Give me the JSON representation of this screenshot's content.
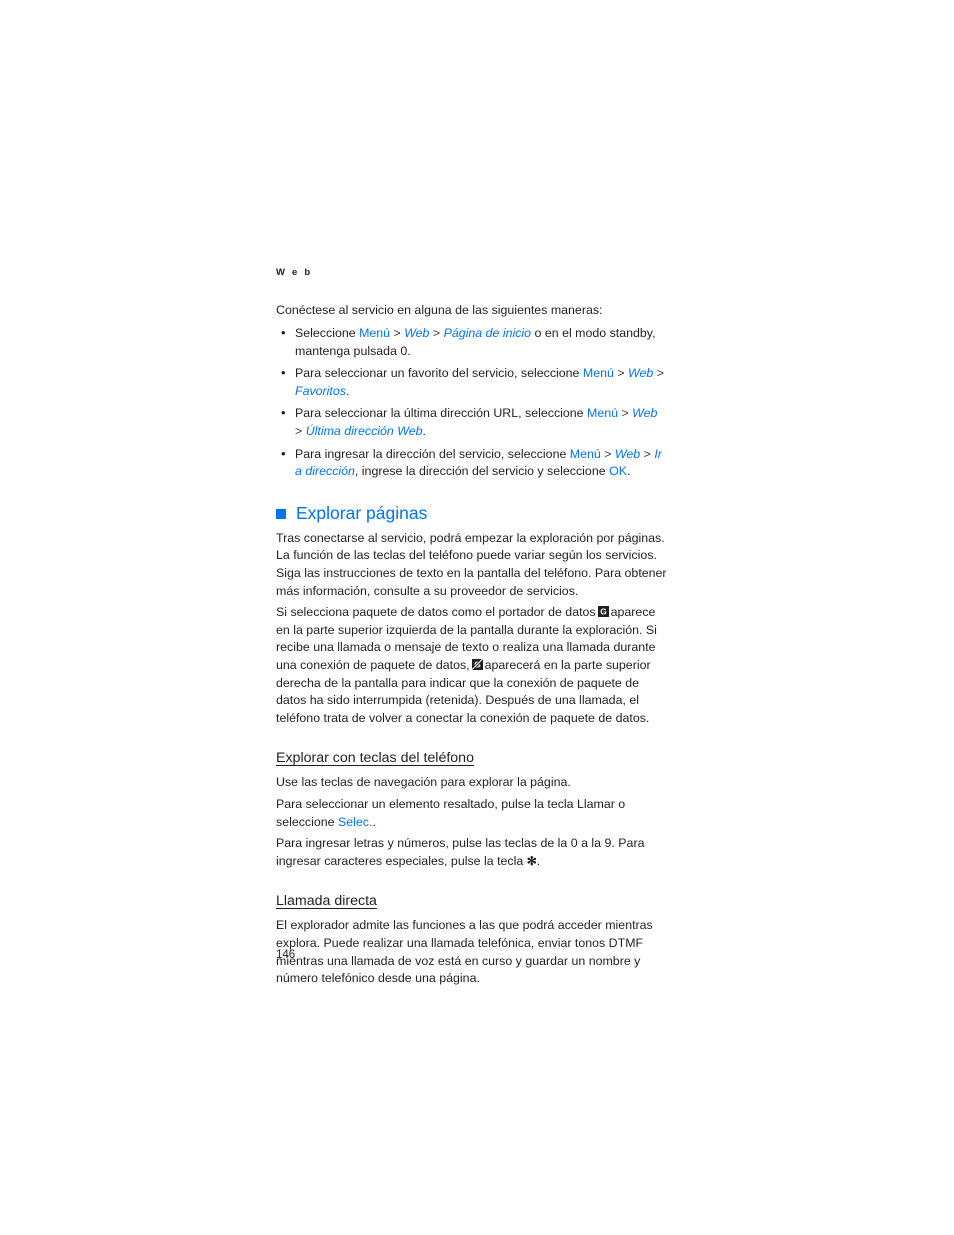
{
  "running_head": "W e b",
  "colors": {
    "link_blue": "#0073f0",
    "body_text": "#231f20"
  },
  "intro": {
    "lead": "Conéctese al servicio en alguna de las siguientes maneras:"
  },
  "bullets": [
    {
      "parts": [
        {
          "text": "Seleccione ",
          "style": "plain"
        },
        {
          "text": "Menú",
          "style": "link"
        },
        {
          "text": " > ",
          "style": "sep"
        },
        {
          "text": "Web",
          "style": "link-italic"
        },
        {
          "text": " > ",
          "style": "sep"
        },
        {
          "text": "Página de inicio",
          "style": "link-italic"
        },
        {
          "text": " o en el modo standby, mantenga pulsada 0.",
          "style": "plain"
        }
      ]
    },
    {
      "parts": [
        {
          "text": "Para seleccionar un favorito del servicio, seleccione ",
          "style": "plain"
        },
        {
          "text": "Menú",
          "style": "link"
        },
        {
          "text": " > ",
          "style": "sep"
        },
        {
          "text": "Web",
          "style": "link-italic"
        },
        {
          "text": " > ",
          "style": "sep"
        },
        {
          "text": "Favoritos",
          "style": "link-italic"
        },
        {
          "text": ".",
          "style": "plain"
        }
      ]
    },
    {
      "parts": [
        {
          "text": "Para seleccionar la última dirección URL, seleccione ",
          "style": "plain"
        },
        {
          "text": "Menú",
          "style": "link"
        },
        {
          "text": " > ",
          "style": "sep"
        },
        {
          "text": "Web",
          "style": "link-italic"
        },
        {
          "text": " > ",
          "style": "sep"
        },
        {
          "text": "Última dirección Web",
          "style": "link-italic"
        },
        {
          "text": ".",
          "style": "plain"
        }
      ]
    },
    {
      "parts": [
        {
          "text": "Para ingresar la dirección del servicio, seleccione ",
          "style": "plain"
        },
        {
          "text": "Menú",
          "style": "link"
        },
        {
          "text": " > ",
          "style": "sep"
        },
        {
          "text": "Web",
          "style": "link-italic"
        },
        {
          "text": " > ",
          "style": "sep"
        },
        {
          "text": "Ir a dirección",
          "style": "link-italic"
        },
        {
          "text": ", ingrese la dirección del servicio y seleccione ",
          "style": "plain"
        },
        {
          "text": "OK",
          "style": "link"
        },
        {
          "text": ".",
          "style": "plain"
        }
      ]
    }
  ],
  "section_explorar_paginas": {
    "heading": "Explorar páginas",
    "bullet_icon": "blue-square-icon",
    "para1": "Tras conectarse al servicio, podrá empezar la exploración por páginas. La función de las teclas del teléfono puede variar según los servicios. Siga las instrucciones de texto en la pantalla del teléfono. Para obtener más información, consulte a su proveedor de servicios.",
    "para2_a": "Si selecciona paquete de datos como el portador de datos",
    "icon1": "gprs-indicator-icon",
    "para2_b": "aparece en la parte superior izquierda de la pantalla durante la exploración. Si recibe una llamada o mensaje de texto o realiza una llamada durante una conexión de paquete de datos,",
    "icon2": "gprs-suspended-icon",
    "para2_c": "aparecerá en la parte superior derecha de la pantalla para indicar que la conexión de paquete de datos ha sido interrumpida (retenida). Después de una llamada, el teléfono trata de volver a conectar la conexión de paquete de datos."
  },
  "section_explorar_teclas": {
    "heading": "Explorar con teclas del teléfono",
    "para1": "Use las teclas de navegación para explorar la página.",
    "para2_a": "Para seleccionar un elemento resaltado, pulse la tecla Llamar o seleccione ",
    "para2_link": "Selec.",
    "para2_b": ".",
    "para3_a": "Para ingresar letras y números, pulse las teclas de la 0 a la 9. Para ingresar caracteres especiales, pulse la tecla ",
    "para3_key": "✻",
    "para3_b": "."
  },
  "section_llamada_directa": {
    "heading": "Llamada directa",
    "para1": "El explorador admite las funciones a las que podrá acceder mientras explora. Puede realizar una llamada telefónica, enviar tonos DTMF mientras una llamada de voz está en curso y guardar un nombre y número telefónico desde una página."
  },
  "folio": "146"
}
